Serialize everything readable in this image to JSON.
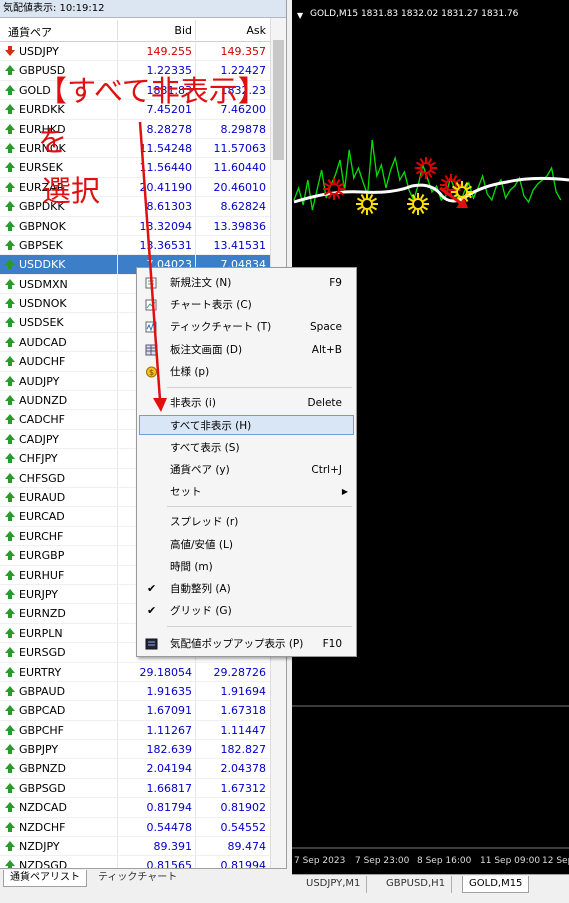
{
  "market_watch": {
    "title": "気配値表示: 10:19:12",
    "col_symbol": "通貨ペア",
    "col_bid": "Bid",
    "col_ask": "Ask",
    "rows": [
      {
        "symbol": "USDJPY",
        "bid": "149.255",
        "ask": "149.357",
        "dir": "down"
      },
      {
        "symbol": "GBPUSD",
        "bid": "1.22335",
        "ask": "1.22427",
        "dir": "up"
      },
      {
        "symbol": "GOLD",
        "bid": "1831.83",
        "ask": "1832.23",
        "dir": "up"
      },
      {
        "symbol": "EURDKK",
        "bid": "7.45201",
        "ask": "7.46200",
        "dir": "up"
      },
      {
        "symbol": "EURHKD",
        "bid": "8.28278",
        "ask": "8.29878",
        "dir": "up"
      },
      {
        "symbol": "EURNOK",
        "bid": "11.54248",
        "ask": "11.57063",
        "dir": "up"
      },
      {
        "symbol": "EURSEK",
        "bid": "11.56440",
        "ask": "11.60440",
        "dir": "up"
      },
      {
        "symbol": "EURZAR",
        "bid": "20.41190",
        "ask": "20.46010",
        "dir": "up"
      },
      {
        "symbol": "GBPDKK",
        "bid": "8.61303",
        "ask": "8.62824",
        "dir": "up"
      },
      {
        "symbol": "GBPNOK",
        "bid": "13.32094",
        "ask": "13.39836",
        "dir": "up"
      },
      {
        "symbol": "GBPSEK",
        "bid": "13.36531",
        "ask": "13.41531",
        "dir": "up"
      },
      {
        "symbol": "USDDKK",
        "bid": "7.04023",
        "ask": "7.04834",
        "dir": "up",
        "selected": true
      },
      {
        "symbol": "USDMXN",
        "bid": "",
        "ask": "",
        "dir": "up"
      },
      {
        "symbol": "USDNOK",
        "bid": "",
        "ask": "",
        "dir": "up"
      },
      {
        "symbol": "USDSEK",
        "bid": "",
        "ask": "",
        "dir": "up"
      },
      {
        "symbol": "AUDCAD",
        "bid": "",
        "ask": "",
        "dir": "up"
      },
      {
        "symbol": "AUDCHF",
        "bid": "",
        "ask": "",
        "dir": "up"
      },
      {
        "symbol": "AUDJPY",
        "bid": "",
        "ask": "",
        "dir": "up"
      },
      {
        "symbol": "AUDNZD",
        "bid": "",
        "ask": "",
        "dir": "up"
      },
      {
        "symbol": "CADCHF",
        "bid": "",
        "ask": "",
        "dir": "up"
      },
      {
        "symbol": "CADJPY",
        "bid": "",
        "ask": "",
        "dir": "up"
      },
      {
        "symbol": "CHFJPY",
        "bid": "",
        "ask": "",
        "dir": "up"
      },
      {
        "symbol": "CHFSGD",
        "bid": "",
        "ask": "",
        "dir": "up"
      },
      {
        "symbol": "EURAUD",
        "bid": "",
        "ask": "",
        "dir": "up"
      },
      {
        "symbol": "EURCAD",
        "bid": "",
        "ask": "",
        "dir": "up"
      },
      {
        "symbol": "EURCHF",
        "bid": "",
        "ask": "",
        "dir": "up"
      },
      {
        "symbol": "EURGBP",
        "bid": "",
        "ask": "",
        "dir": "up"
      },
      {
        "symbol": "EURHUF",
        "bid": "",
        "ask": "",
        "dir": "up"
      },
      {
        "symbol": "EURJPY",
        "bid": "",
        "ask": "",
        "dir": "up"
      },
      {
        "symbol": "EURNZD",
        "bid": "",
        "ask": "",
        "dir": "up"
      },
      {
        "symbol": "EURPLN",
        "bid": "",
        "ask": "",
        "dir": "up"
      },
      {
        "symbol": "EURSGD",
        "bid": "",
        "ask": "",
        "dir": "up"
      },
      {
        "symbol": "EURTRY",
        "bid": "29.18054",
        "ask": "29.28726",
        "dir": "up"
      },
      {
        "symbol": "GBPAUD",
        "bid": "1.91635",
        "ask": "1.91694",
        "dir": "up"
      },
      {
        "symbol": "GBPCAD",
        "bid": "1.67091",
        "ask": "1.67318",
        "dir": "up"
      },
      {
        "symbol": "GBPCHF",
        "bid": "1.11267",
        "ask": "1.11447",
        "dir": "up"
      },
      {
        "symbol": "GBPJPY",
        "bid": "182.639",
        "ask": "182.827",
        "dir": "up"
      },
      {
        "symbol": "GBPNZD",
        "bid": "2.04194",
        "ask": "2.04378",
        "dir": "up"
      },
      {
        "symbol": "GBPSGD",
        "bid": "1.66817",
        "ask": "1.67312",
        "dir": "up"
      },
      {
        "symbol": "NZDCAD",
        "bid": "0.81794",
        "ask": "0.81902",
        "dir": "up"
      },
      {
        "symbol": "NZDCHF",
        "bid": "0.54478",
        "ask": "0.54552",
        "dir": "up"
      },
      {
        "symbol": "NZDJPY",
        "bid": "89.391",
        "ask": "89.474",
        "dir": "up"
      },
      {
        "symbol": "NZDSGD",
        "bid": "0.81565",
        "ask": "0.81994",
        "dir": "up"
      }
    ],
    "tabs": [
      "通貨ペアリスト",
      "ティックチャート"
    ]
  },
  "chart": {
    "title": "GOLD,M15  1831.83 1832.02 1831.27 1831.76",
    "date_labels": [
      "7 Sep 2023",
      "7 Sep 23:00",
      "8 Sep 16:00",
      "11 Sep 09:00",
      "12 Sep"
    ],
    "tabs": [
      "USDJPY,M1",
      "GBPUSD,H1",
      "GOLD,M15"
    ],
    "active_tab": "GOLD,M15",
    "colors": {
      "price": "#00e000",
      "ma": "#ffffff",
      "buy_marker": "#ffe000",
      "sell_marker": "#e00000"
    }
  },
  "context_menu": {
    "items": [
      {
        "label": "新規注文 (N)",
        "key": "F9",
        "icon": "new-order-icon"
      },
      {
        "label": "チャート表示 (C)",
        "key": "",
        "icon": "chart-window-icon"
      },
      {
        "label": "ティックチャート (T)",
        "key": "Space",
        "icon": "tick-chart-icon"
      },
      {
        "label": "板注文画面 (D)",
        "key": "Alt+B",
        "icon": "depth-of-market-icon"
      },
      {
        "label": "仕様 (p)",
        "key": "",
        "icon": "specification-icon"
      },
      {
        "label": "非表示 (i)",
        "key": "Delete"
      },
      {
        "label": "すべて非表示 (H)",
        "key": "",
        "highlighted": true
      },
      {
        "label": "すべて表示 (S)",
        "key": ""
      },
      {
        "label": "通貨ペア (y)",
        "key": "Ctrl+J"
      },
      {
        "label": "セット",
        "key": "",
        "submenu": true
      },
      {
        "label": "スプレッド (r)",
        "key": ""
      },
      {
        "label": "高値/安値 (L)",
        "key": ""
      },
      {
        "label": "時間 (m)",
        "key": ""
      },
      {
        "label": "自動整列 (A)",
        "key": "",
        "checked": true
      },
      {
        "label": "グリッド (G)",
        "key": "",
        "checked": true
      },
      {
        "label": "気配値ポップアップ表示 (P)",
        "key": "F10",
        "icon": "popup-icon"
      }
    ]
  },
  "annotation": {
    "line1": "【すべて非表示】を",
    "line2": "選択",
    "color": "#e01010"
  }
}
